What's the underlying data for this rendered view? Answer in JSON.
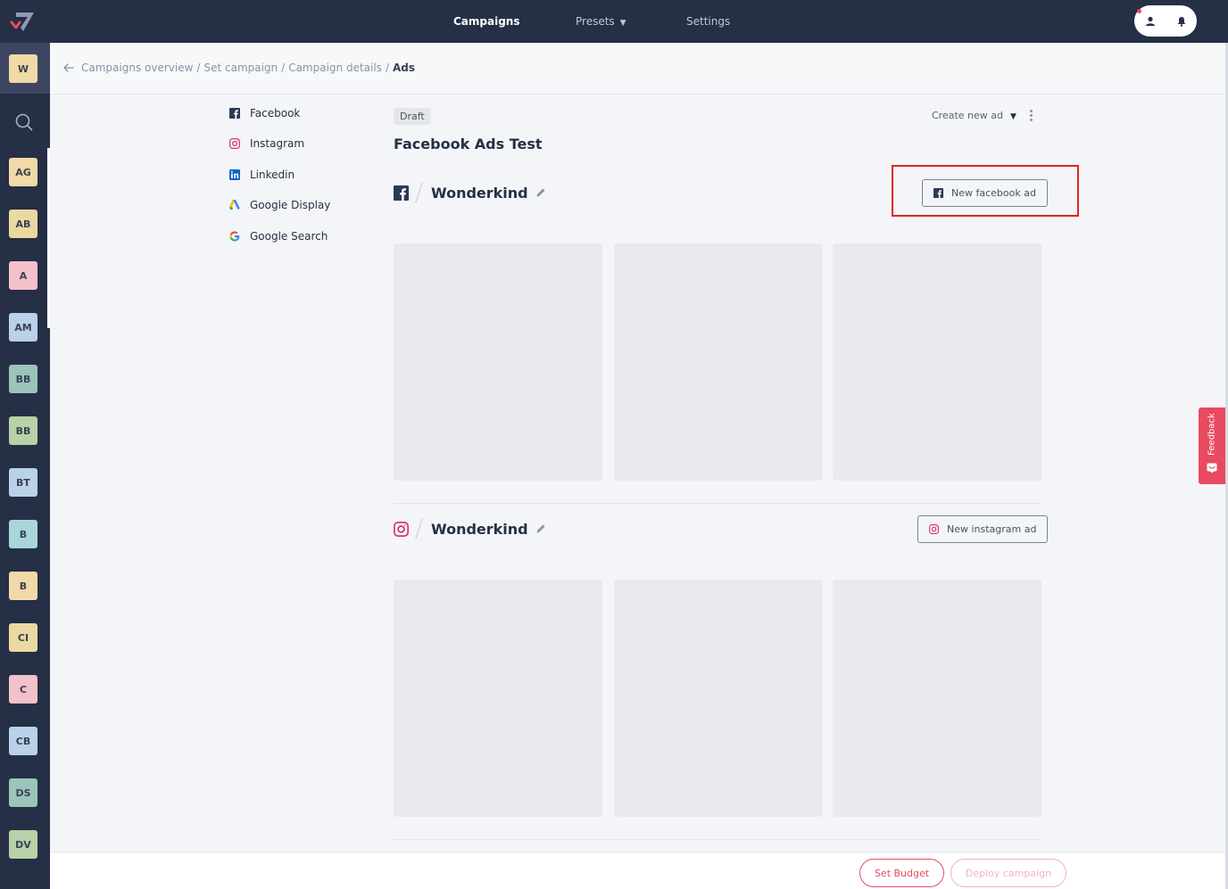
{
  "topnav": {
    "items": [
      {
        "label": "Campaigns",
        "active": true
      },
      {
        "label": "Presets",
        "has_dropdown": true
      },
      {
        "label": "Settings"
      }
    ]
  },
  "rail": {
    "avatars": [
      {
        "initials": "W",
        "color": "#f1d9a8"
      },
      {
        "initials": "AG",
        "color": "#f1d9a8"
      },
      {
        "initials": "AB",
        "color": "#ead9a0"
      },
      {
        "initials": "A",
        "color": "#f2c1c9"
      },
      {
        "initials": "AM",
        "color": "#b9d2ea"
      },
      {
        "initials": "BB",
        "color": "#9bc4ba"
      },
      {
        "initials": "BB",
        "color": "#b7d1a8"
      },
      {
        "initials": "BT",
        "color": "#b9d2ea"
      },
      {
        "initials": "B",
        "color": "#a9d6da"
      },
      {
        "initials": "B",
        "color": "#f1d9a8"
      },
      {
        "initials": "CI",
        "color": "#ead9a0"
      },
      {
        "initials": "C",
        "color": "#f2c1c9"
      },
      {
        "initials": "CB",
        "color": "#b9d2ea"
      },
      {
        "initials": "DS",
        "color": "#9bc4ba"
      },
      {
        "initials": "DV",
        "color": "#b7d1a8"
      }
    ]
  },
  "breadcrumb": {
    "items": [
      "Campaigns overview",
      "Set campaign",
      "Campaign details"
    ],
    "current": "Ads"
  },
  "channels": [
    {
      "label": "Facebook",
      "icon": "facebook-icon"
    },
    {
      "label": "Instagram",
      "icon": "instagram-icon"
    },
    {
      "label": "Linkedin",
      "icon": "linkedin-icon"
    },
    {
      "label": "Google Display",
      "icon": "google-ads-icon"
    },
    {
      "label": "Google Search",
      "icon": "google-icon"
    }
  ],
  "main": {
    "status": "Draft",
    "create_new_label": "Create new ad",
    "title": "Facebook Ads Test",
    "sections": [
      {
        "platform": "facebook",
        "account": "Wonderkind",
        "button_label": "New facebook ad"
      },
      {
        "platform": "instagram",
        "account": "Wonderkind",
        "button_label": "New instagram ad"
      }
    ]
  },
  "feedback_label": "Feedback",
  "footer": {
    "set_budget": "Set Budget",
    "deploy": "Deploy campaign"
  },
  "colors": {
    "navbar": "#252f45",
    "accent": "#e84a5f",
    "facebook": "#2b3a55",
    "highlight": "#e0241f"
  }
}
